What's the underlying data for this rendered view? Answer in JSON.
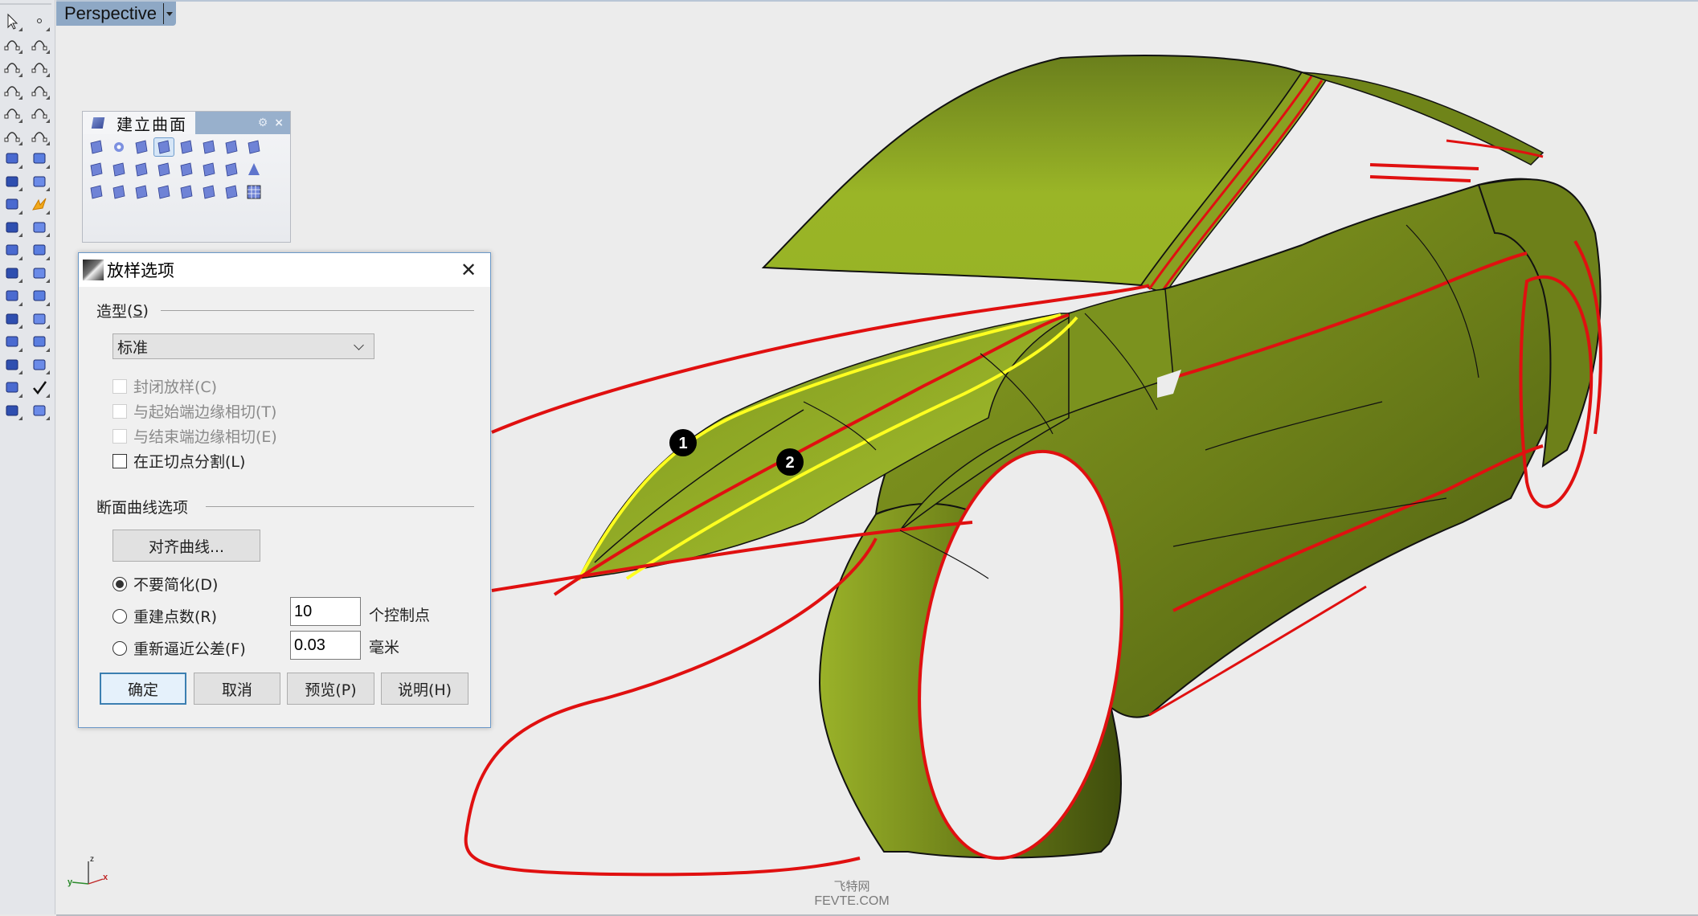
{
  "viewport": {
    "name": "Perspective",
    "axes": {
      "x": "x",
      "y": "y",
      "z": "z"
    },
    "control_points": [
      {
        "label": "1"
      },
      {
        "label": "2"
      }
    ],
    "colors": {
      "surface": "#8fa824",
      "curve_red": "#e01010",
      "curve_selected": "#ffff20",
      "background": "#ececec"
    }
  },
  "left_toolbar": {
    "tools": [
      "select-icon",
      "point-icon",
      "polyline-icon",
      "curve-icon",
      "circle-icon",
      "ellipse-icon",
      "arc-icon",
      "rectangle-icon",
      "polygon-icon",
      "fillet-icon",
      "surface-from-points-icon",
      "surface-edge-icon",
      "box-icon",
      "sphere-icon",
      "extrude-icon",
      "patch-icon",
      "explode-icon",
      "boolean-icon",
      "split-icon",
      "trim-icon",
      "fillet-solid-icon",
      "point-cloud-icon",
      "offset-curve-icon",
      "curve-tools-icon",
      "text-icon",
      "scale-icon",
      "array-icon",
      "orient-icon",
      "solid-tools-icon",
      "dimension-icon",
      "grid-array-icon",
      "gumball-icon",
      "render-icon",
      "check-icon",
      "light-icon",
      "material-icon"
    ]
  },
  "surface_panel": {
    "title": "建立曲面",
    "tools": [
      "corner-points-surface-icon",
      "edge-curves-icon",
      "planar-curves-icon",
      "loft-icon",
      "rectangular-plane-icon",
      "extrude-surface-icon",
      "plane-icon",
      "plane-3pt-icon",
      "vertical-plane-icon",
      "network-surface-icon",
      "cutting-plane-icon",
      "heightfield-icon",
      "extrude-curve-icon",
      "revolve-icon",
      "rail-revolve-icon",
      "cone-icon",
      "sweep1-icon",
      "patch-surface-icon",
      "sweep2-icon",
      "blend-icon",
      "tube-icon",
      "drape-icon",
      "uvn-icon",
      "point-grid-icon"
    ],
    "active_index": 3
  },
  "dialog": {
    "title": "放样选项",
    "style_group": {
      "label": "造型",
      "mnemonic": "S",
      "selected": "标准"
    },
    "options": [
      {
        "label": "封闭放样(C)",
        "checked": false,
        "enabled": false
      },
      {
        "label": "与起始端边缘相切(T)",
        "checked": false,
        "enabled": false
      },
      {
        "label": "与结束端边缘相切(E)",
        "checked": false,
        "enabled": false
      },
      {
        "label": "在正切点分割(L)",
        "checked": false,
        "enabled": true
      }
    ],
    "section_group": {
      "label": "断面曲线选项",
      "align_button": "对齐曲线...",
      "radios": [
        {
          "label": "不要简化(D)",
          "selected": true
        },
        {
          "label": "重建点数(R)",
          "selected": false,
          "value": "10",
          "unit": "个控制点"
        },
        {
          "label": "重新逼近公差(F)",
          "selected": false,
          "value": "0.03",
          "unit": "毫米"
        }
      ]
    },
    "buttons": {
      "ok": "确定",
      "cancel": "取消",
      "preview": "预览(P)",
      "help": "说明(H)"
    }
  },
  "watermark": {
    "cn": "飞特网",
    "en": "FEVTE.COM"
  }
}
